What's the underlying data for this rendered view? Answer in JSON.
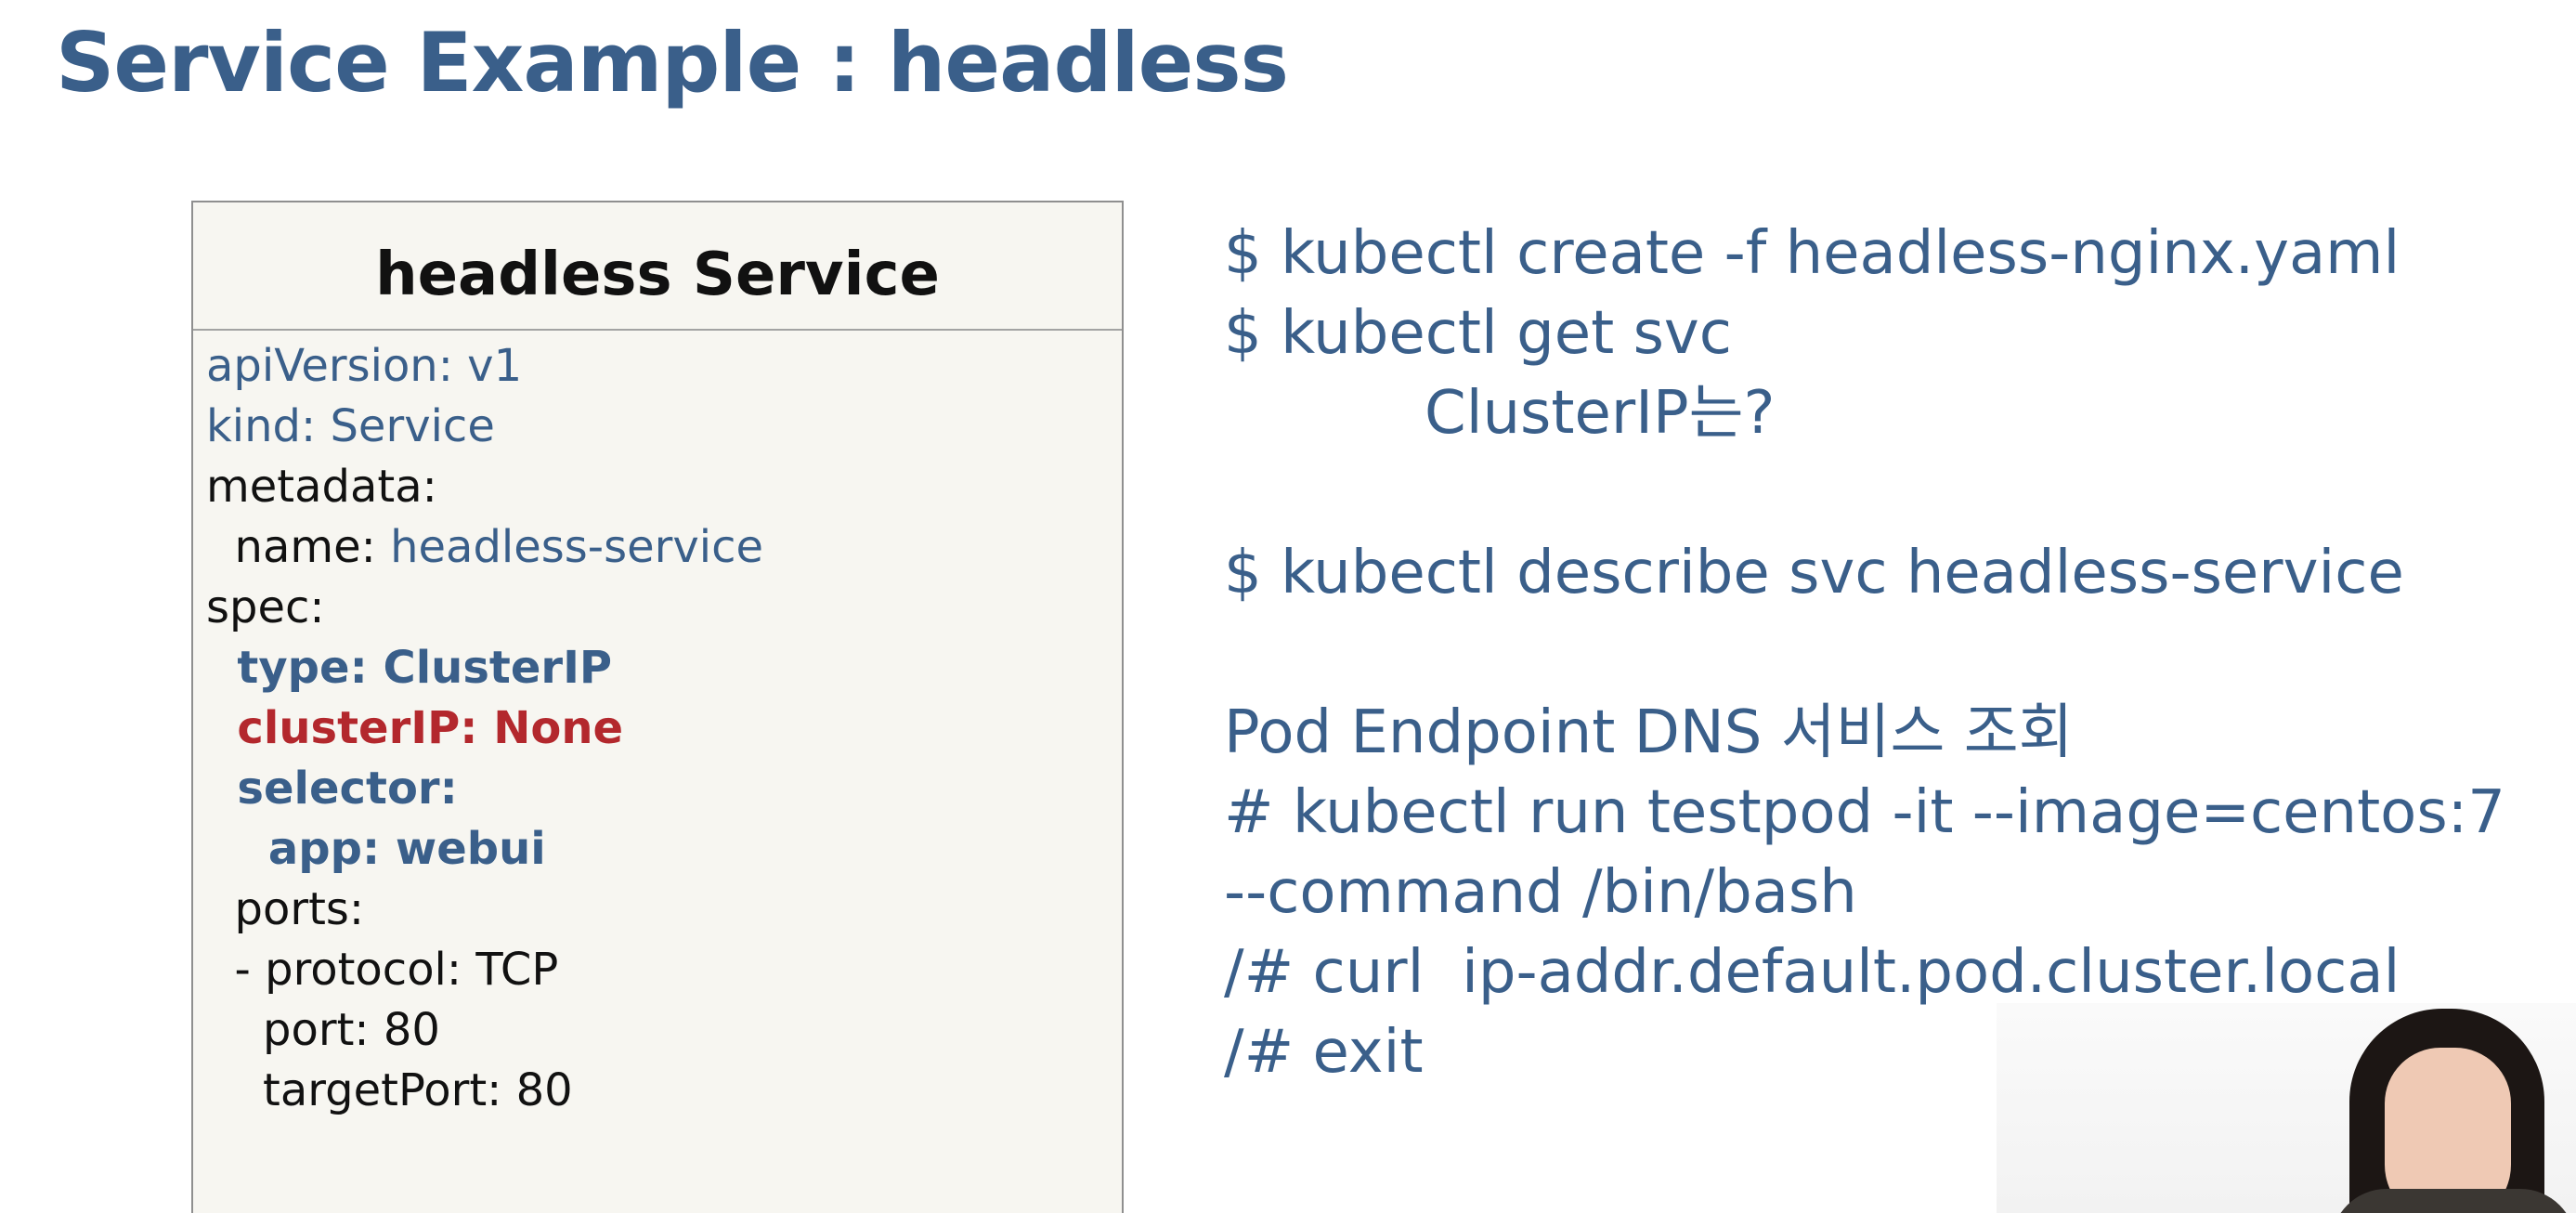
{
  "slide": {
    "title": "Service Example : headless"
  },
  "yaml_box": {
    "title": "headless Service",
    "lines": {
      "l1": "apiVersion: v1",
      "l2": "kind: Service",
      "l3": "metadata:",
      "l4_key": "  name: ",
      "l4_val": "headless-service",
      "l5": "spec:",
      "l6": "  type: ClusterIP",
      "l7": "  clusterIP: None",
      "l8": "  selector:",
      "l9": "    app: webui",
      "l10": "  ports:",
      "l11": "  - protocol: TCP",
      "l12": "    port: 80",
      "l13": "    targetPort: 80"
    }
  },
  "commands": {
    "c1": "$ kubectl create -f headless-nginx.yaml",
    "c2": "$ kubectl get svc",
    "c3": "ClusterIP는?",
    "c4": "$ kubectl describe svc headless-service",
    "c5": "Pod Endpoint DNS 서비스 조회",
    "c6": "# kubectl run testpod -it --image=centos:7",
    "c7": "--command /bin/bash",
    "c8": "/# curl  ip-addr.default.pod.cluster.local",
    "c9": "/# exit"
  },
  "colors": {
    "accent_blue": "#3a5f8a",
    "highlight_red": "#b3282d",
    "box_background": "#f7f6f1"
  }
}
